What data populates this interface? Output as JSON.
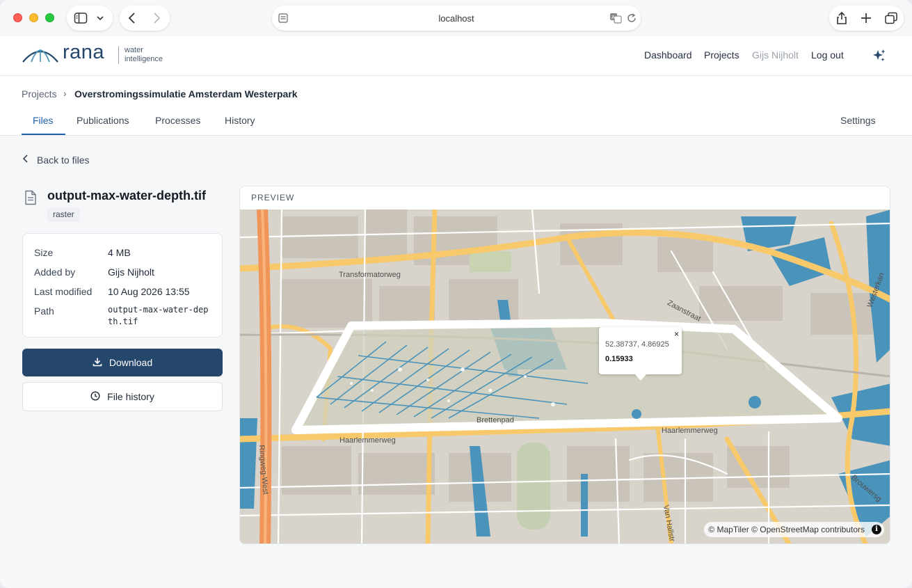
{
  "browser": {
    "url": "localhost"
  },
  "app": {
    "logo_word": "rana",
    "logo_sub_line1": "water",
    "logo_sub_line2": "intelligence",
    "nav": {
      "dashboard": "Dashboard",
      "projects": "Projects",
      "user": "Gijs Nijholt",
      "logout": "Log out"
    }
  },
  "breadcrumb": {
    "root": "Projects",
    "separator": "›",
    "current": "Overstromingssimulatie Amsterdam Westerpark"
  },
  "tabs": {
    "files": "Files",
    "publications": "Publications",
    "processes": "Processes",
    "history": "History",
    "settings": "Settings"
  },
  "back_link": "Back to files",
  "file": {
    "name": "output-max-water-depth.tif",
    "type_tag": "raster",
    "meta": [
      {
        "key": "Size",
        "value": "4 MB"
      },
      {
        "key": "Added by",
        "value": "Gijs Nijholt"
      },
      {
        "key": "Last modified",
        "value": "10 Aug 2026 13:55"
      },
      {
        "key": "Path",
        "value": "output-max-water-depth.tif"
      }
    ],
    "download_label": "Download",
    "history_label": "File history"
  },
  "preview": {
    "label": "PREVIEW",
    "popup": {
      "coords": "52.38737, 4.86925",
      "value": "0.15933",
      "close": "×"
    },
    "street_labels": {
      "transformatorweg": "Transformatorweg",
      "zaanstraat": "Zaanstraat",
      "haarlemmerweg_w": "Haarlemmerweg",
      "haarlemmerweg_e": "Haarlemmerweg",
      "ringweg": "Ringweg-West",
      "van_hallstraat": "Van Hallstr",
      "westerkade": "Westerkan",
      "brouwersgracht": "Brouwersg",
      "brettenpad": "Brettenpad"
    },
    "attribution": "© MapTiler © OpenStreetMap contributors",
    "info_glyph": "i"
  },
  "colors": {
    "brand": "#24476b",
    "accent": "#1d5fa8",
    "water": "#4a93ba",
    "major_road": "#f7c96b",
    "ring_road": "#f0955a"
  }
}
